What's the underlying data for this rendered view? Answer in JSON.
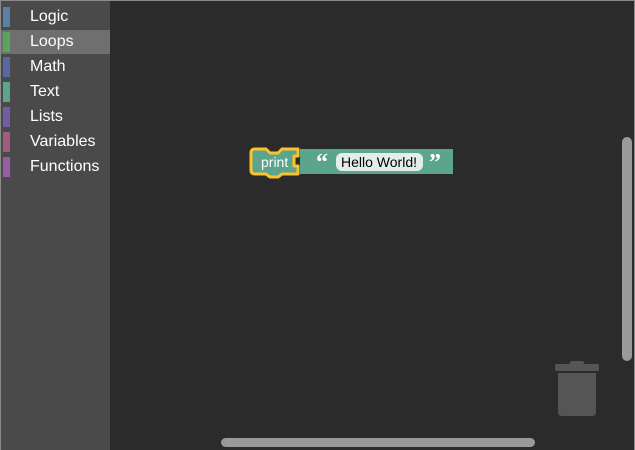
{
  "toolbox": {
    "categories": [
      {
        "label": "Logic",
        "color": "#5b80a5"
      },
      {
        "label": "Loops",
        "color": "#5ba55b"
      },
      {
        "label": "Math",
        "color": "#5b67a5"
      },
      {
        "label": "Text",
        "color": "#5ba58c"
      },
      {
        "label": "Lists",
        "color": "#745ba5"
      },
      {
        "label": "Variables",
        "color": "#a55b80"
      },
      {
        "label": "Functions",
        "color": "#995ba5"
      }
    ],
    "selected": "Loops"
  },
  "workspace": {
    "print_block": {
      "label": "print",
      "color": "#5ba58c",
      "highlight": "#fcc22e"
    },
    "text_block": {
      "open_quote": "“",
      "value": "Hello World!",
      "close_quote": "”",
      "color": "#5ba58c"
    }
  },
  "icons": {
    "trash": "trash-icon"
  }
}
